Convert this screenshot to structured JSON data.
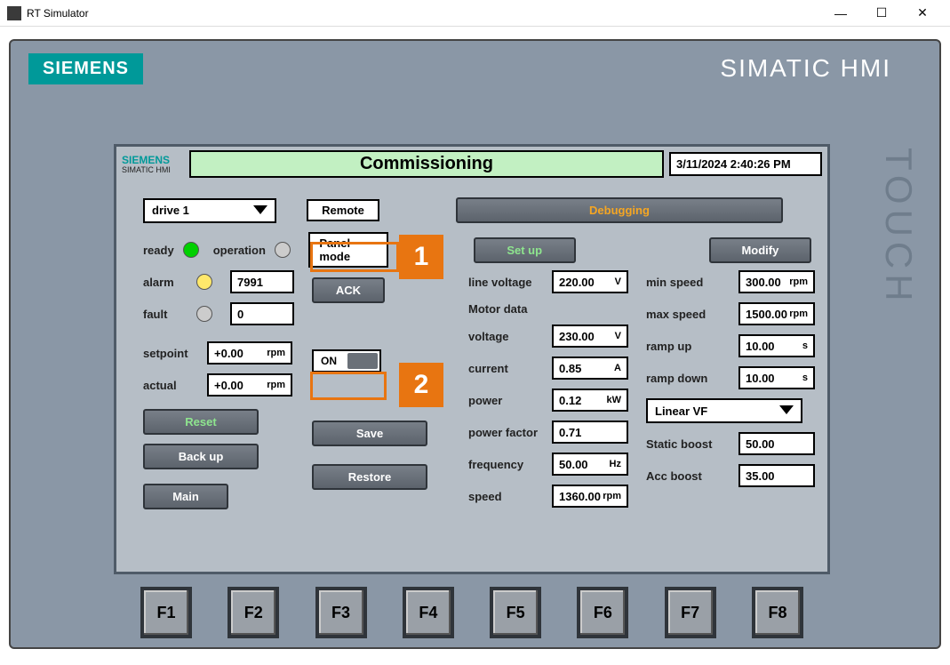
{
  "window": {
    "title": "RT Simulator"
  },
  "brand": {
    "siemens": "SIEMENS",
    "simatic_hmi": "SIMATIC HMI",
    "touch": "TOUCH"
  },
  "header": {
    "siemens": "SIEMENS",
    "sub": "SIMATIC HMI",
    "title": "Commissioning",
    "timestamp": "3/11/2024 2:40:26 PM"
  },
  "topbar": {
    "drive_selected": "drive 1",
    "remote": "Remote",
    "panel_mode": "Panel mode",
    "debugging": "Debugging",
    "setup": "Set up",
    "modify": "Modify"
  },
  "status": {
    "ready_label": "ready",
    "operation_label": "operation",
    "alarm_label": "alarm",
    "alarm_value": "7991",
    "fault_label": "fault",
    "fault_value": "0",
    "ack": "ACK",
    "on": "ON"
  },
  "drive": {
    "setpoint_label": "setpoint",
    "setpoint_value": "+0.00",
    "setpoint_unit": "rpm",
    "actual_label": "actual",
    "actual_value": "+0.00",
    "actual_unit": "rpm"
  },
  "buttons": {
    "reset": "Reset",
    "save": "Save",
    "backup": "Back up",
    "restore": "Restore",
    "main": "Main"
  },
  "measure": {
    "line_voltage_label": "line voltage",
    "line_voltage": "220.00",
    "line_voltage_unit": "V",
    "motor_data_label": "Motor data",
    "voltage_label": "voltage",
    "voltage": "230.00",
    "voltage_unit": "V",
    "current_label": "current",
    "current": "0.85",
    "current_unit": "A",
    "power_label": "power",
    "power": "0.12",
    "power_unit": "kW",
    "pf_label": "power factor",
    "pf": "0.71",
    "freq_label": "frequency",
    "freq": "50.00",
    "freq_unit": "Hz",
    "speed_label": "speed",
    "speed": "1360.00",
    "speed_unit": "rpm"
  },
  "limits": {
    "min_speed_label": "min speed",
    "min_speed": "300.00",
    "min_speed_unit": "rpm",
    "max_speed_label": "max speed",
    "max_speed": "1500.00",
    "max_speed_unit": "rpm",
    "ramp_up_label": "ramp up",
    "ramp_up": "10.00",
    "ramp_up_unit": "s",
    "ramp_down_label": "ramp down",
    "ramp_down": "10.00",
    "ramp_down_unit": "s",
    "vf_mode": "Linear VF",
    "static_boost_label": "Static boost",
    "static_boost": "50.00",
    "acc_boost_label": "Acc boost",
    "acc_boost": "35.00"
  },
  "fkeys": [
    "F1",
    "F2",
    "F3",
    "F4",
    "F5",
    "F6",
    "F7",
    "F8"
  ],
  "callouts": {
    "one": "1",
    "two": "2"
  }
}
